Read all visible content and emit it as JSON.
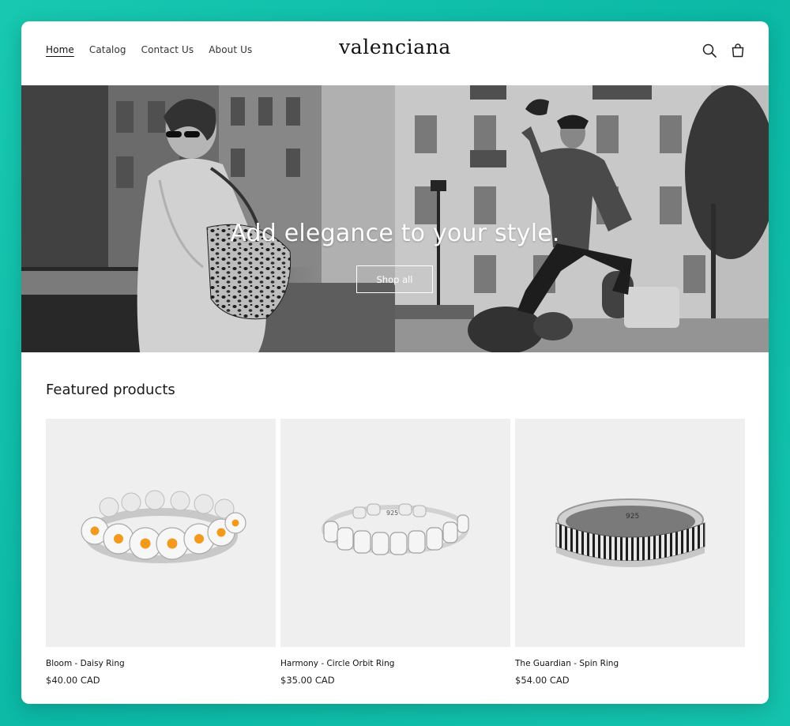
{
  "header": {
    "nav": [
      "Home",
      "Catalog",
      "Contact Us",
      "About Us"
    ],
    "logo": "valenciana",
    "icons": [
      "search-icon",
      "cart-icon"
    ]
  },
  "hero": {
    "title": "Add elegance to your style.",
    "button_label": "Shop all"
  },
  "featured": {
    "title": "Featured products",
    "products": [
      {
        "name": "Bloom - Daisy Ring",
        "price": "$40.00 CAD",
        "engraving": ""
      },
      {
        "name": "Harmony - Circle Orbit Ring",
        "price": "$35.00 CAD",
        "engraving": "925"
      },
      {
        "name": "The Guardian - Spin Ring",
        "price": "$54.00 CAD",
        "engraving": "925"
      }
    ]
  },
  "colors": {
    "background": "#12c2ab",
    "daisy_center": "#f39a1e",
    "thumb_bg": "#efefef"
  }
}
